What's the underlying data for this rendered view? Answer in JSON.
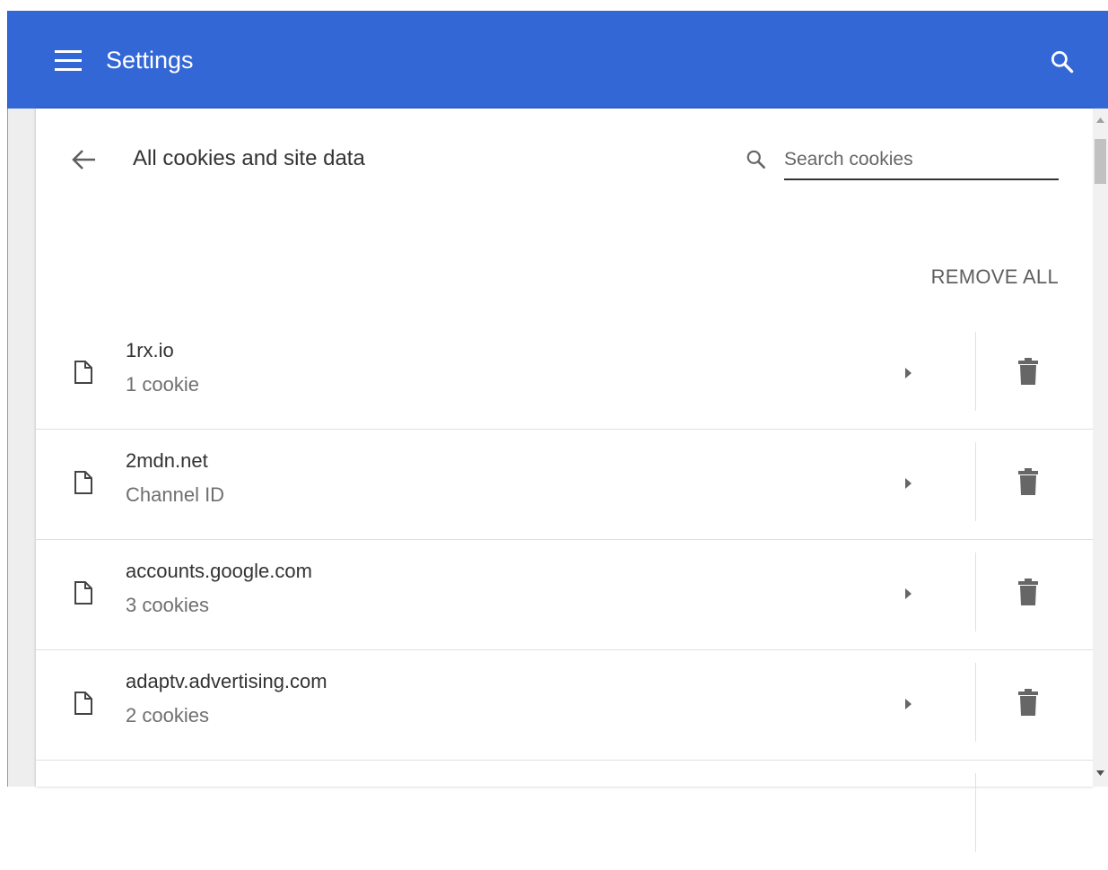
{
  "header": {
    "title": "Settings",
    "bg_color": "#3367d6",
    "menu_icon": "hamburger-menu-icon",
    "search_icon": "search-icon"
  },
  "page": {
    "title": "All cookies and site data",
    "back_icon": "arrow-back-icon",
    "search": {
      "placeholder": "Search cookies",
      "value": ""
    },
    "remove_all_label": "REMOVE ALL"
  },
  "sites": [
    {
      "name": "1rx.io",
      "detail": "1 cookie"
    },
    {
      "name": "2mdn.net",
      "detail": "Channel ID"
    },
    {
      "name": "accounts.google.com",
      "detail": "3 cookies"
    },
    {
      "name": "adaptv.advertising.com",
      "detail": "2 cookies"
    },
    {
      "name": "",
      "detail": ""
    }
  ],
  "row_icons": {
    "site": "file-icon",
    "expand": "arrow-right-icon",
    "delete": "trash-icon"
  }
}
